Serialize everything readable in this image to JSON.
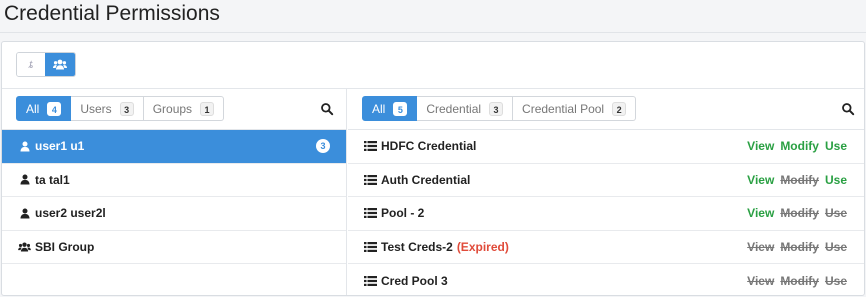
{
  "page": {
    "title": "Credential Permissions"
  },
  "view_toggle": {
    "left_glyph": "ȶ"
  },
  "left_panel": {
    "filters": [
      {
        "label": "All",
        "count": "4",
        "active": true
      },
      {
        "label": "Users",
        "count": "3",
        "active": false
      },
      {
        "label": "Groups",
        "count": "1",
        "active": false
      }
    ],
    "items": [
      {
        "label": "user1 u1",
        "type": "user",
        "count": "3",
        "selected": true
      },
      {
        "label": "ta tal1",
        "type": "user",
        "selected": false
      },
      {
        "label": "user2 user2l",
        "type": "user",
        "selected": false
      },
      {
        "label": "SBI Group",
        "type": "group",
        "selected": false
      }
    ]
  },
  "right_panel": {
    "filters": [
      {
        "label": "All",
        "count": "5",
        "active": true
      },
      {
        "label": "Credential",
        "count": "3",
        "active": false
      },
      {
        "label": "Credential Pool",
        "count": "2",
        "active": false
      }
    ],
    "items": [
      {
        "label": "HDFC Credential",
        "status": "",
        "view": "View",
        "modify": "Modify",
        "use": "Use",
        "view_on": true,
        "modify_on": true,
        "use_on": true
      },
      {
        "label": "Auth Credential",
        "status": "",
        "view": "View",
        "modify": "Modify",
        "use": "Use",
        "view_on": true,
        "modify_on": false,
        "use_on": true
      },
      {
        "label": "Pool - 2",
        "status": "",
        "view": "View",
        "modify": "Modify",
        "use": "Use",
        "view_on": true,
        "modify_on": false,
        "use_on": false
      },
      {
        "label": "Test Creds-2",
        "status": "(Expired)",
        "view": "View",
        "modify": "Modify",
        "use": "Use",
        "view_on": false,
        "modify_on": false,
        "use_on": false
      },
      {
        "label": "Cred Pool 3",
        "status": "",
        "view": "View",
        "modify": "Modify",
        "use": "Use",
        "view_on": false,
        "modify_on": false,
        "use_on": false
      }
    ]
  },
  "colors": {
    "accent": "#3b8edb",
    "enabled": "#2aa043",
    "disabled": "#777777",
    "expired": "#e04b3a"
  },
  "icons": {
    "user": "user-icon",
    "group": "group-icon",
    "list": "list-icon",
    "search": "search-icon"
  }
}
